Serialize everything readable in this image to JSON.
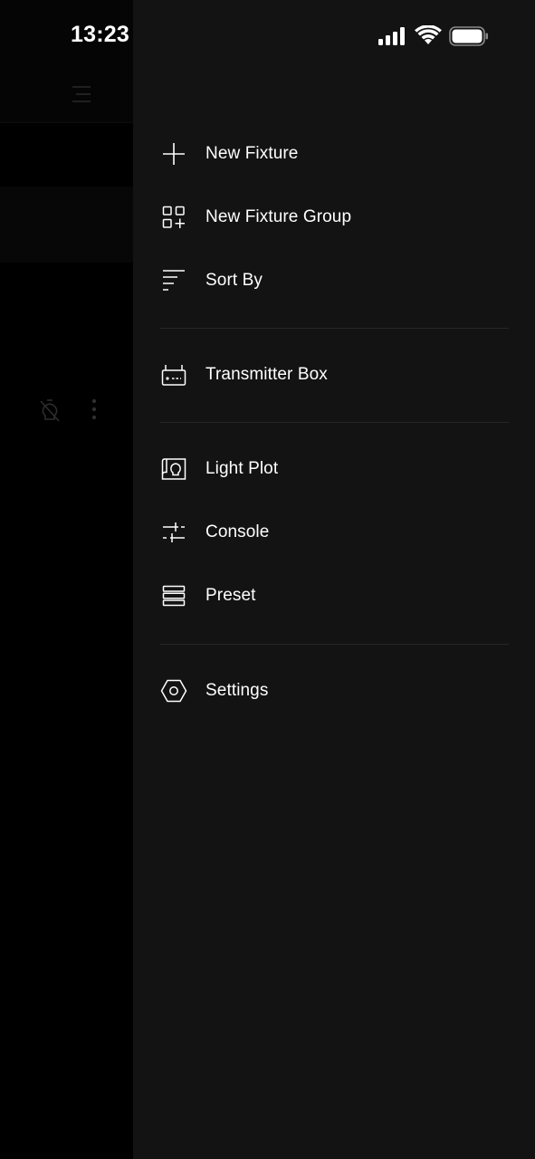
{
  "status_bar": {
    "time": "13:23"
  },
  "menu": {
    "items": [
      {
        "label": "New Fixture",
        "icon": "plus-icon"
      },
      {
        "label": "New Fixture Group",
        "icon": "grid-add-icon"
      },
      {
        "label": "Sort By",
        "icon": "sort-icon"
      },
      {
        "label": "Transmitter Box",
        "icon": "transmitter-icon"
      },
      {
        "label": "Light Plot",
        "icon": "light-plot-icon"
      },
      {
        "label": "Console",
        "icon": "console-sliders-icon"
      },
      {
        "label": "Preset",
        "icon": "preset-list-icon"
      },
      {
        "label": "Settings",
        "icon": "settings-hex-icon"
      }
    ]
  },
  "colors": {
    "drawer_bg": "#131313",
    "divider": "#262626",
    "text": "#ffffff"
  }
}
